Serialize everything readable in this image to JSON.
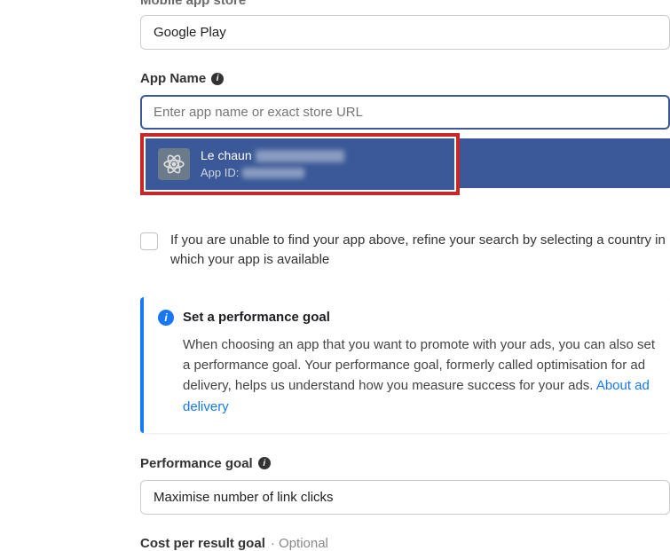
{
  "store": {
    "label": "Mobile app store",
    "value": "Google Play"
  },
  "appName": {
    "label": "App Name",
    "placeholder": "Enter app name or exact store URL"
  },
  "dropdown": {
    "itemName": "Le     chaun",
    "itemSub": "App ID:"
  },
  "refine": {
    "text": "If you are unable to find your app above, refine your search by selecting a country in which your app is available"
  },
  "infoPanel": {
    "title": "Set a performance goal",
    "body": "When choosing an app that you want to promote with your ads, you can also set a performance goal. Your performance goal, formerly called optimisation for ad delivery, helps us understand how you measure success for your ads. ",
    "link": "About ad delivery"
  },
  "perfGoal": {
    "label": "Performance goal",
    "value": "Maximise number of link clicks"
  },
  "costGoal": {
    "label": "Cost per result goal",
    "optional": "· Optional"
  }
}
